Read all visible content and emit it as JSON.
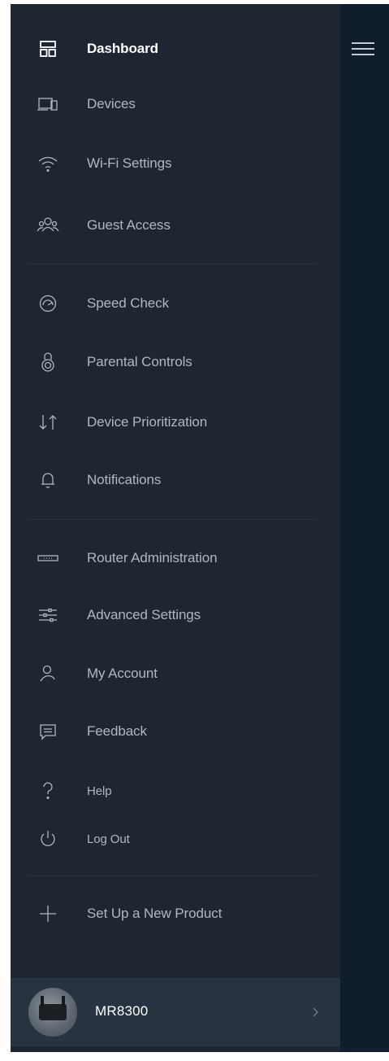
{
  "menu": {
    "items": [
      {
        "label": "Dashboard",
        "icon": "dashboard-icon",
        "active": true
      },
      {
        "label": "Devices",
        "icon": "devices-icon"
      },
      {
        "label": "Wi-Fi Settings",
        "icon": "wifi-icon"
      },
      {
        "label": "Guest Access",
        "icon": "guest-access-icon"
      },
      {
        "label": "Speed Check",
        "icon": "speedometer-icon"
      },
      {
        "label": "Parental Controls",
        "icon": "padlock-icon"
      },
      {
        "label": "Device Prioritization",
        "icon": "up-down-arrows-icon"
      },
      {
        "label": "Notifications",
        "icon": "bell-icon"
      },
      {
        "label": "Router Administration",
        "icon": "router-icon"
      },
      {
        "label": "Advanced Settings",
        "icon": "sliders-icon"
      },
      {
        "label": "My Account",
        "icon": "person-icon"
      },
      {
        "label": "Feedback",
        "icon": "chat-bubble-icon"
      },
      {
        "label": "Help",
        "icon": "question-mark-icon"
      },
      {
        "label": "Log Out",
        "icon": "power-icon"
      },
      {
        "label": "Set Up a New Product",
        "icon": "plus-icon"
      }
    ]
  },
  "device": {
    "name": "MR8300",
    "icon": "router-avatar",
    "chevron": "chevron-right-icon"
  },
  "header": {
    "menu_icon": "hamburger-menu-icon"
  },
  "colors": {
    "panel": "#1e2631",
    "strip": "#0f1d2c",
    "text": "#aeb8c3",
    "active_text": "#ffffff",
    "device_row": "#283341"
  }
}
